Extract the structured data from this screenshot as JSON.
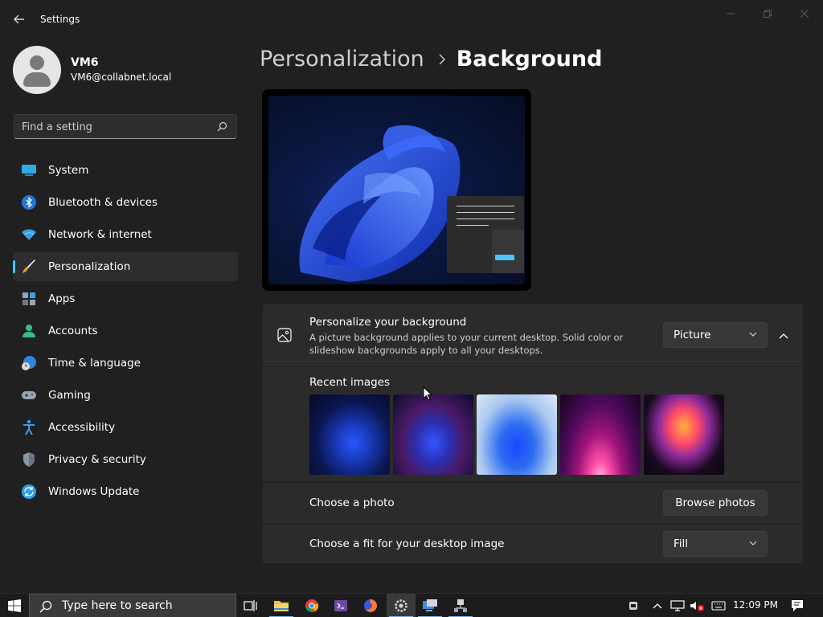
{
  "window": {
    "title": "Settings"
  },
  "profile": {
    "name": "VM6",
    "email": "VM6@collabnet.local"
  },
  "search": {
    "placeholder": "Find a setting"
  },
  "nav": {
    "items": [
      {
        "label": "System",
        "icon": "monitor-icon"
      },
      {
        "label": "Bluetooth & devices",
        "icon": "bluetooth-icon"
      },
      {
        "label": "Network & internet",
        "icon": "wifi-icon"
      },
      {
        "label": "Personalization",
        "icon": "paintbrush-icon",
        "active": true
      },
      {
        "label": "Apps",
        "icon": "apps-icon"
      },
      {
        "label": "Accounts",
        "icon": "person-icon"
      },
      {
        "label": "Time & language",
        "icon": "globe-clock-icon"
      },
      {
        "label": "Gaming",
        "icon": "gamepad-icon"
      },
      {
        "label": "Accessibility",
        "icon": "accessibility-icon"
      },
      {
        "label": "Privacy & security",
        "icon": "shield-icon"
      },
      {
        "label": "Windows Update",
        "icon": "update-icon"
      }
    ]
  },
  "breadcrumb": {
    "parent": "Personalization",
    "current": "Background"
  },
  "background": {
    "title": "Personalize your background",
    "description": "A picture background applies to your current desktop. Solid color or slideshow backgrounds apply to all your desktops.",
    "type_value": "Picture",
    "recent_label": "Recent images",
    "thumbnails": [
      "bloom-dark-blue",
      "bloom-dark-purple",
      "bloom-light",
      "glow-magenta",
      "ribbon-flower"
    ],
    "choose_photo_label": "Choose a photo",
    "browse_label": "Browse photos",
    "fit_label": "Choose a fit for your desktop image",
    "fit_value": "Fill"
  },
  "taskbar": {
    "search_placeholder": "Type here to search",
    "clock": "12:09 PM"
  },
  "colors": {
    "accent": "#4cc2ff",
    "background": "#202020",
    "card": "#2b2b2b"
  }
}
